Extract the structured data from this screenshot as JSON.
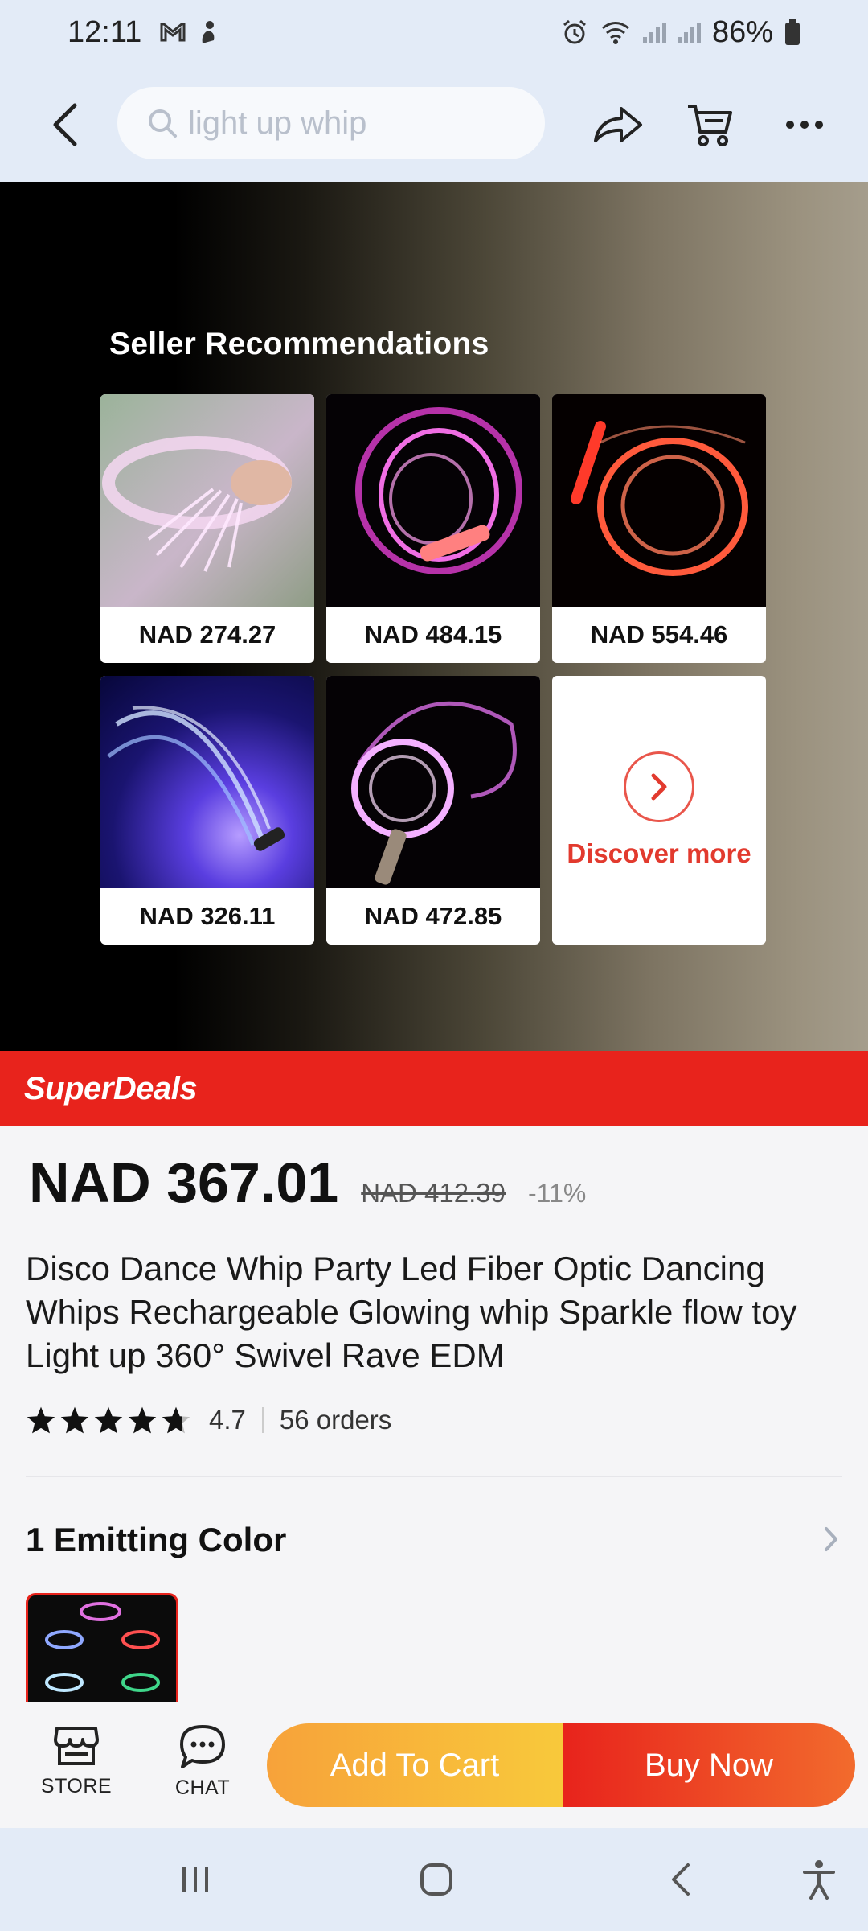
{
  "status_bar": {
    "time": "12:11",
    "battery": "86%"
  },
  "header": {
    "search_placeholder": "light up whip"
  },
  "recommendations": {
    "title": "Seller Recommendations",
    "items": [
      {
        "price": "NAD 274.27"
      },
      {
        "price": "NAD 484.15"
      },
      {
        "price": "NAD 554.46"
      },
      {
        "price": "NAD 326.11"
      },
      {
        "price": "NAD 472.85"
      }
    ],
    "discover_label": "Discover more"
  },
  "deal": {
    "label": "SuperDeals"
  },
  "product": {
    "price": "NAD 367.01",
    "original_price": "NAD 412.39",
    "discount": "-11%",
    "title": "Disco Dance Whip Party Led Fiber Optic Dancing Whips Rechargeable Glowing whip Sparkle flow toy Light up 360° Swivel Rave EDM",
    "rating": "4.7",
    "rating_stars": 4.7,
    "orders": "56 orders"
  },
  "variant": {
    "title": "1 Emitting Color"
  },
  "actions": {
    "store_label": "STORE",
    "chat_label": "CHAT",
    "add_to_cart_label": "Add To Cart",
    "buy_now_label": "Buy Now"
  },
  "colors": {
    "accent_red": "#e8231c",
    "accent_orange": "#f7a23a"
  }
}
